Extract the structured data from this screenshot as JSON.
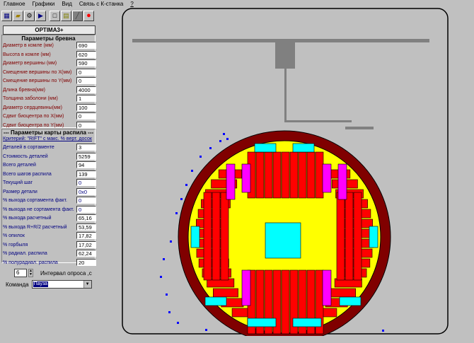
{
  "menu": [
    {
      "label": "Главное"
    },
    {
      "label": "Графики"
    },
    {
      "label": "Вид"
    },
    {
      "label": "Связь с К-станка"
    },
    {
      "label": "?"
    }
  ],
  "toolbar": [
    {
      "icon": "table-icon",
      "glyph": "▦"
    },
    {
      "icon": "open-icon",
      "glyph": "📂"
    },
    {
      "icon": "gear-icon",
      "glyph": "⚙"
    },
    {
      "icon": "run-icon",
      "glyph": "▶"
    },
    {
      "icon": "new-document-icon",
      "glyph": "🗋"
    },
    {
      "icon": "save-icon",
      "glyph": "▤"
    },
    {
      "icon": "stop-icon",
      "glyph": "■"
    },
    {
      "icon": "record-icon",
      "glyph": "●"
    }
  ],
  "app_title": "OPTIMA3+",
  "log_params": {
    "title": "Параметры бревна",
    "fields": [
      {
        "label": "Диаметр в комле (мм)",
        "value": "690"
      },
      {
        "label": "Высота в комле (мм)",
        "value": "620"
      },
      {
        "label": "Диаметр вершины (мм)",
        "value": "590"
      },
      {
        "label": "Смещение вершины по X(мм)",
        "value": "0"
      },
      {
        "label": "Смещение вершины по Y(мм)",
        "value": "0"
      },
      {
        "label": "Длина бревна(мм)",
        "value": "4000"
      },
      {
        "label": "Толщина заболони (мм)",
        "value": "1"
      },
      {
        "label": "Диаметр сердцевины(мм)",
        "value": "100"
      },
      {
        "label": "Сдвиг биоцентра по X(мм)",
        "value": "0"
      },
      {
        "label": "Сдвиг биоцентра по Y(мм)",
        "value": "0"
      }
    ]
  },
  "cut_params": {
    "title": "--- Параметры карты распила ---",
    "criterion": "Критерий: \"RIFT\" с макс. % верт. досок",
    "fields": [
      {
        "label": "Деталей в сортаменте",
        "value": "3"
      },
      {
        "label": "Стоимость деталей",
        "value": "5259"
      },
      {
        "label": "Всего деталей",
        "value": "94"
      },
      {
        "label": "Всего шагов распила",
        "value": "139"
      },
      {
        "label": "Текущий шаг",
        "value": "0"
      },
      {
        "label": "Размер детали",
        "value": "0x0"
      },
      {
        "label": "% выхода сортамента факт.",
        "value": "0"
      },
      {
        "label": "% выхода не сортамента факт.",
        "value": "0"
      },
      {
        "label": "% выхода расчетный",
        "value": "65,16"
      },
      {
        "label": "% выхода R+R/2 расчетный",
        "value": "53,59"
      },
      {
        "label": "%  опилок",
        "value": "17,82"
      },
      {
        "label": "%  горбыля",
        "value": "17,02"
      },
      {
        "label": "%  радиал. распила",
        "value": "62,24"
      },
      {
        "label": "%  полурадиал. распила",
        "value": "20"
      }
    ]
  },
  "interval": {
    "value": "6",
    "label": "Интервал  опроса ,с"
  },
  "command": {
    "label": "Команда",
    "value": "Пауза"
  },
  "colors": {
    "log_outer": "#800000",
    "log_sapwood": "#ffff00",
    "board_red": "#ff0000",
    "board_cyan": "#00ffff",
    "board_magenta": "#ff00ff",
    "core": "#00ffff",
    "dot": "#0000ff"
  }
}
